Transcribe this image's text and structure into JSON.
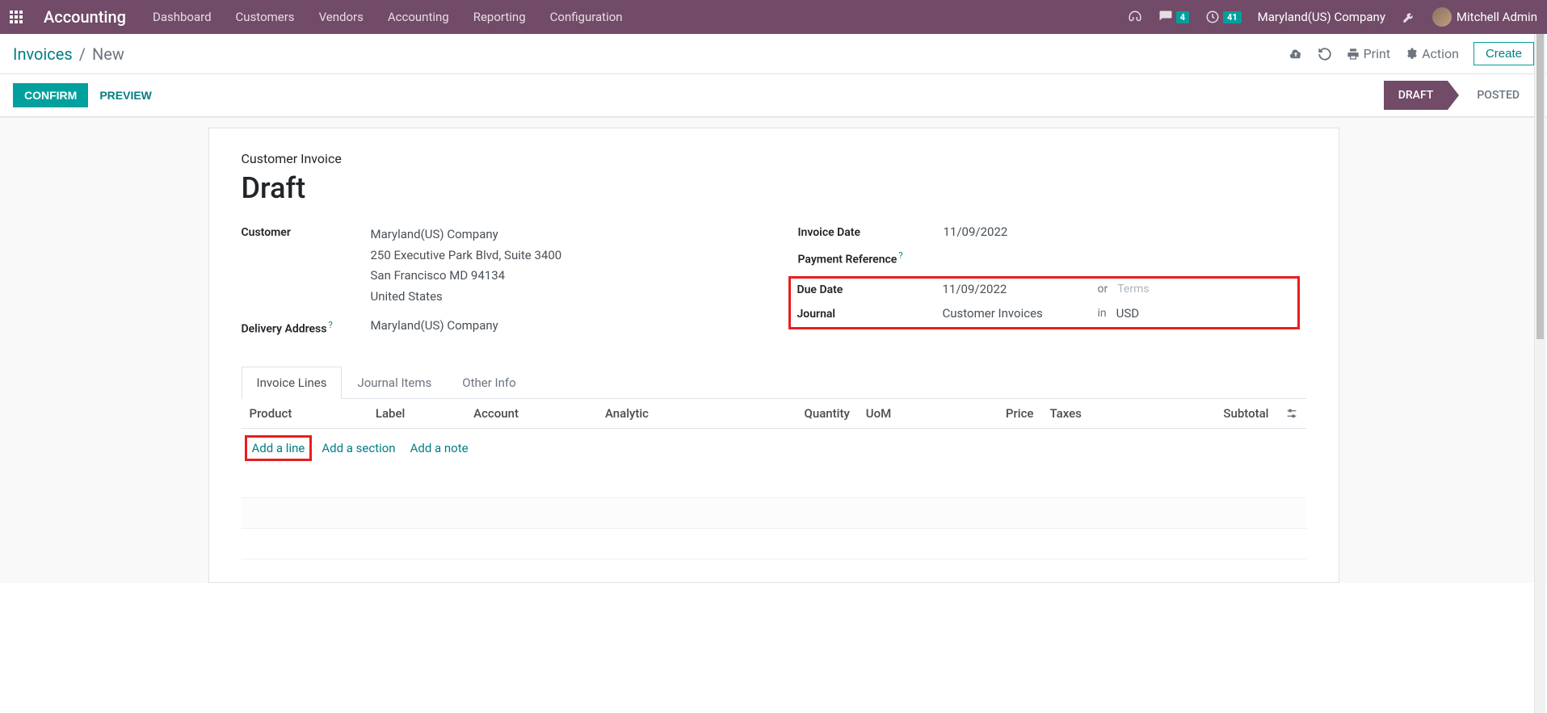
{
  "navbar": {
    "brand": "Accounting",
    "menu": [
      "Dashboard",
      "Customers",
      "Vendors",
      "Accounting",
      "Reporting",
      "Configuration"
    ],
    "messages_badge": "4",
    "activities_badge": "41",
    "company": "Maryland(US) Company",
    "user": "Mitchell Admin"
  },
  "control": {
    "breadcrumb_root": "Invoices",
    "breadcrumb_current": "New",
    "print": "Print",
    "action": "Action",
    "create": "Create"
  },
  "statusbar": {
    "confirm": "CONFIRM",
    "preview": "PREVIEW",
    "draft": "DRAFT",
    "posted": "POSTED"
  },
  "form": {
    "subtitle": "Customer Invoice",
    "title": "Draft",
    "labels": {
      "customer": "Customer",
      "delivery_address": "Delivery Address",
      "invoice_date": "Invoice Date",
      "payment_reference": "Payment Reference",
      "due_date": "Due Date",
      "journal": "Journal"
    },
    "values": {
      "customer": "Maryland(US) Company",
      "addr1": "250 Executive Park Blvd, Suite 3400",
      "addr2": "San Francisco MD 94134",
      "addr3": "United States",
      "delivery_address": "Maryland(US) Company",
      "invoice_date": "11/09/2022",
      "payment_reference": "",
      "due_date": "11/09/2022",
      "due_or": "or",
      "terms_placeholder": "Terms",
      "journal": "Customer Invoices",
      "journal_in": "in",
      "currency": "USD"
    }
  },
  "tabs": [
    "Invoice Lines",
    "Journal Items",
    "Other Info"
  ],
  "table": {
    "headers": [
      "Product",
      "Label",
      "Account",
      "Analytic",
      "Quantity",
      "UoM",
      "Price",
      "Taxes",
      "Subtotal"
    ],
    "actions": {
      "add_line": "Add a line",
      "add_section": "Add a section",
      "add_note": "Add a note"
    }
  }
}
